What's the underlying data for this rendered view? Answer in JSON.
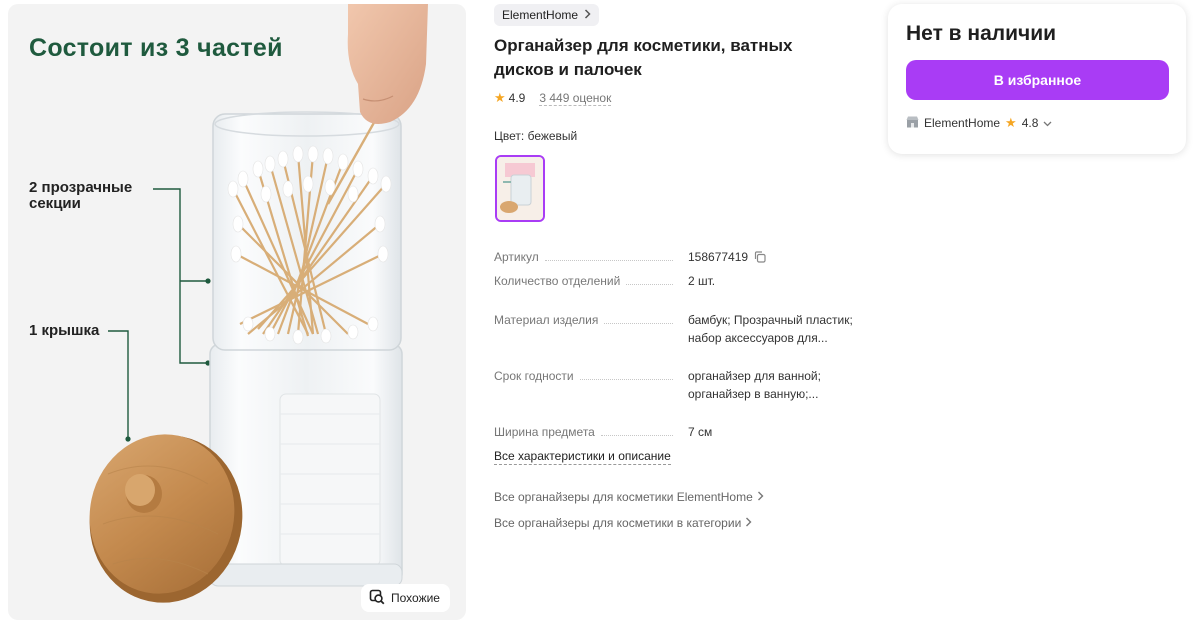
{
  "gallery": {
    "promo_title": "Состоит из 3 частей",
    "label_sections": "2 прозрачные секции",
    "label_lid": "1 крышка",
    "similar_label": "Похожие"
  },
  "product": {
    "brand": "ElementHome",
    "title": "Органайзер для косметики, ватных дисков и палочек",
    "rating": "4.9",
    "reviews": "3 449 оценок",
    "color_prefix": "Цвет:",
    "color_value": "бежевый"
  },
  "specs": [
    {
      "key": "Артикул",
      "value": "158677419"
    },
    {
      "key": "Количество отделений",
      "value": "2 шт."
    },
    {
      "key": "Материал изделия",
      "value": "бамбук; Прозрачный пластик; набор аксессуаров для..."
    },
    {
      "key": "Срок годности",
      "value": "органайзер для ванной; органайзер в ванную;..."
    },
    {
      "key": "Ширина предмета",
      "value": "7 см"
    }
  ],
  "links": {
    "all_specs": "Все характеристики и описание",
    "brand_products": "Все органайзеры для косметики ElementHome",
    "category_products": "Все органайзеры для косметики в категории"
  },
  "card": {
    "stock_status": "Нет в наличии",
    "favorite_button": "В избранное",
    "seller_name": "ElementHome",
    "seller_rating": "4.8"
  },
  "colors": {
    "accent": "#a93cf5",
    "promo_green": "#1f5a3e",
    "star": "#f5a623"
  }
}
